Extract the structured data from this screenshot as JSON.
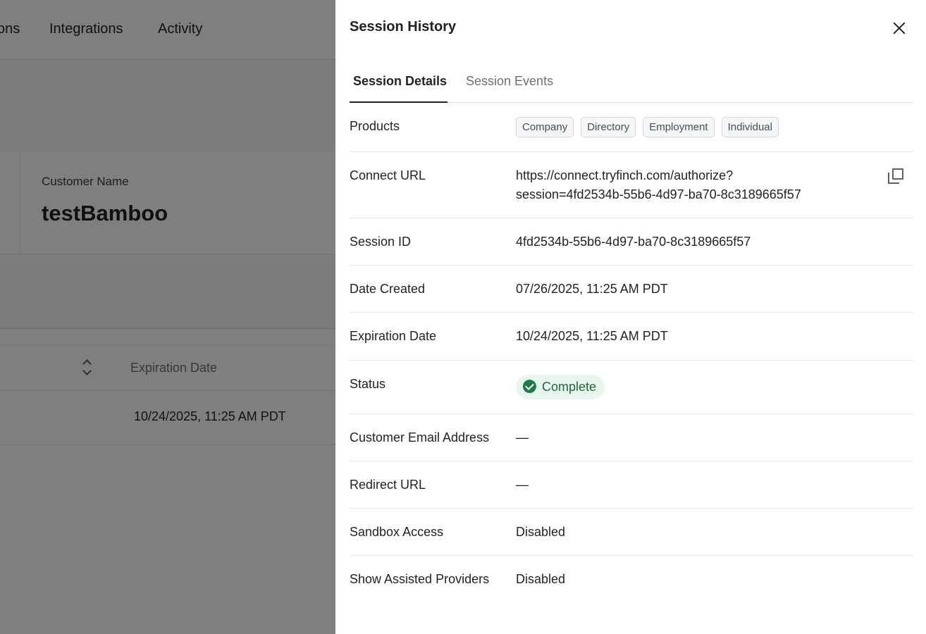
{
  "background": {
    "nav_items": [
      "ons",
      "Integrations",
      "Activity"
    ],
    "customer_label": "Customer Name",
    "customer_value": "testBamboo",
    "table_header": "Expiration Date",
    "table_cell": "10/24/2025, 11:25 AM PDT"
  },
  "drawer": {
    "title": "Session History",
    "tabs": [
      "Session Details",
      "Session Events"
    ],
    "active_tab": "Session Details",
    "products_label": "Products",
    "products": [
      "Company",
      "Directory",
      "Employment",
      "Individual"
    ],
    "connect_url_label": "Connect URL",
    "connect_url_line1": "https://connect.tryfinch.com/authorize?",
    "connect_url_line2": "session=4fd2534b-55b6-4d97-ba70-8c3189665f57",
    "session_id_label": "Session ID",
    "session_id": "4fd2534b-55b6-4d97-ba70-8c3189665f57",
    "date_created_label": "Date Created",
    "date_created": "07/26/2025, 11:25 AM PDT",
    "expiration_label": "Expiration Date",
    "expiration": "10/24/2025, 11:25 AM PDT",
    "status_label": "Status",
    "status": "Complete",
    "customer_email_label": "Customer Email Address",
    "customer_email": "—",
    "redirect_url_label": "Redirect URL",
    "redirect_url": "—",
    "sandbox_label": "Sandbox Access",
    "sandbox": "Disabled",
    "assisted_label": "Show Assisted Providers",
    "assisted": "Disabled"
  },
  "colors": {
    "status_bg": "#e9f6ee",
    "status_text": "#1f6a3c",
    "overlay": "rgba(0,0,0,0.5)"
  },
  "icons": [
    "close-icon",
    "copy-icon",
    "check-circle-icon",
    "sort-icon"
  ]
}
